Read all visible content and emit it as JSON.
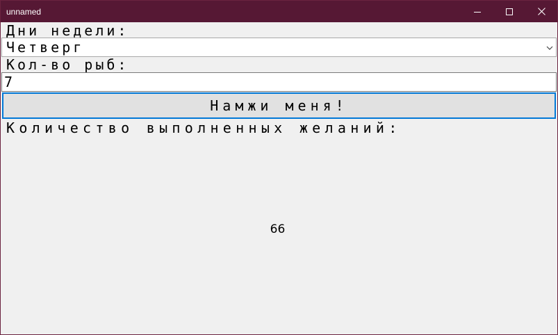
{
  "window": {
    "title": "unnamed",
    "controls": {
      "minimize_icon": "minimize-icon",
      "maximize_icon": "maximize-icon",
      "close_icon": "close-icon"
    }
  },
  "form": {
    "days_label": "Дни недели:",
    "days_selected": "Четверг",
    "fish_label": "Кол-во рыб:",
    "fish_value": "7",
    "button_label": "Намжи меня!",
    "wishes_label": "Количество выполненных желаний:",
    "wishes_result": "66"
  },
  "colors": {
    "titlebar": "#561834",
    "client_bg": "#f0f0f0",
    "button_focus_border": "#0078d7",
    "button_bg": "#e1e1e1"
  }
}
